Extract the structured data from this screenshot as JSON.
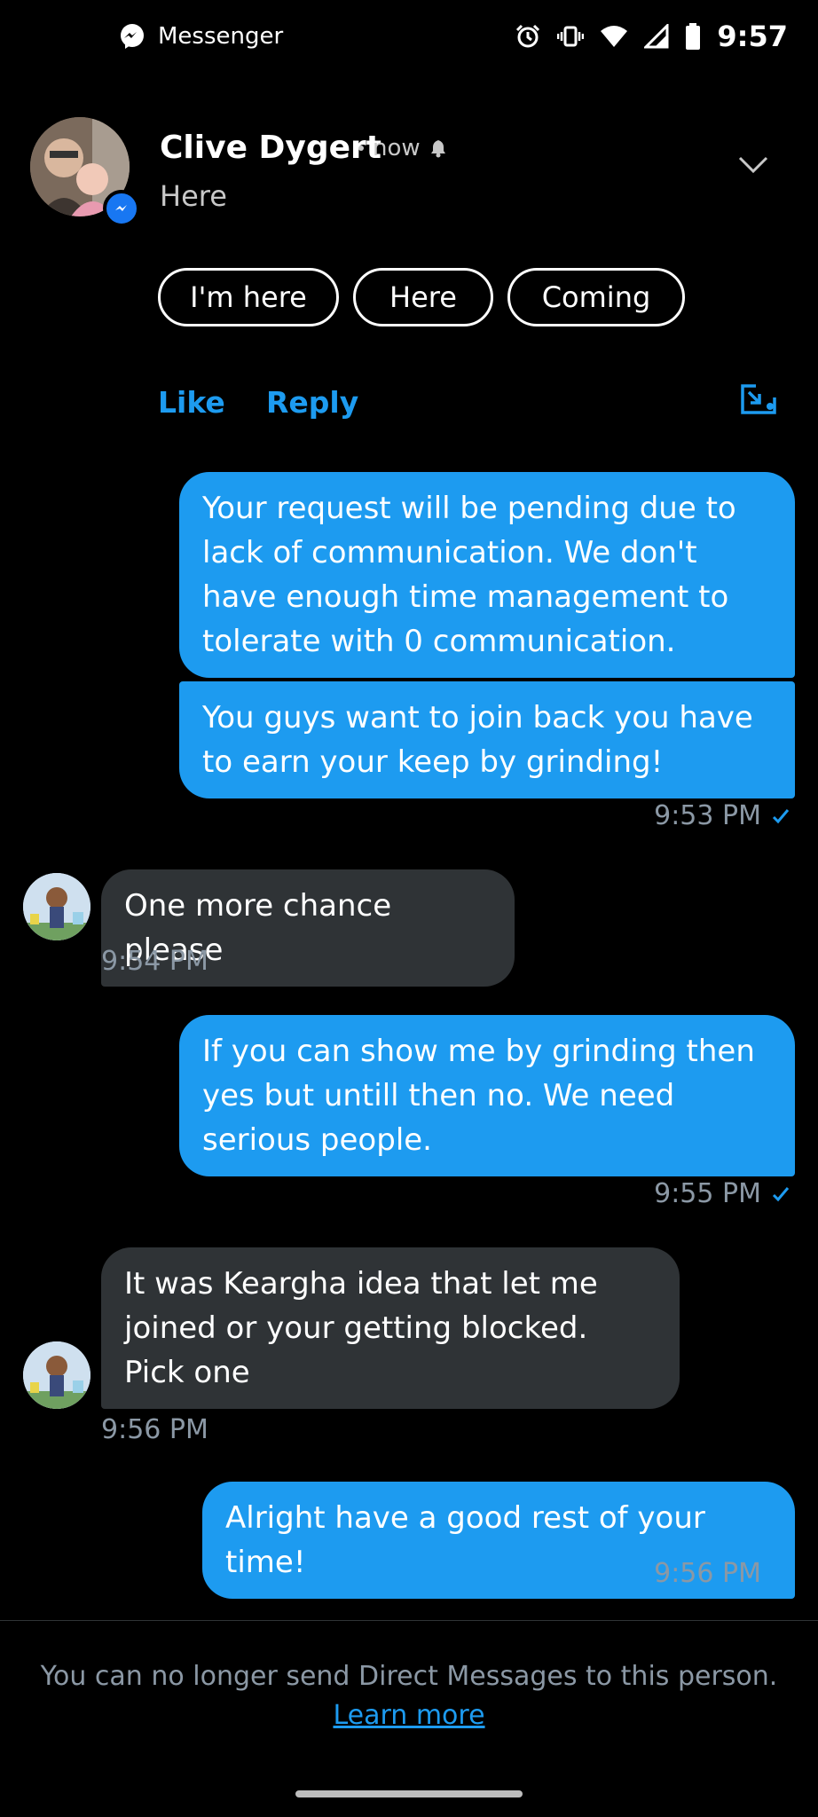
{
  "status_bar": {
    "app_name": "Messenger",
    "time": "9:57",
    "icons": [
      "alarm-icon",
      "vibrate-icon",
      "wifi-icon",
      "signal-icon",
      "battery-icon"
    ]
  },
  "notification": {
    "sender": "Clive Dygert",
    "time": "now",
    "message": "Here",
    "quick_replies": [
      "I'm here",
      "Here",
      "Coming"
    ],
    "actions": {
      "like": "Like",
      "reply": "Reply"
    }
  },
  "messages": [
    {
      "direction": "out",
      "text": "Your request will be pending due to lack of communication. We don't have enough time management to tolerate with 0 communication."
    },
    {
      "direction": "out",
      "text": "You guys want to join back you have to earn your keep by grinding!",
      "timestamp": "9:53 PM",
      "read": true
    },
    {
      "direction": "in",
      "text": "One more chance please",
      "timestamp": "9:54 PM"
    },
    {
      "direction": "out",
      "text": "If you can show me by grinding then yes but untill then no. We need serious people.",
      "timestamp": "9:55 PM",
      "read": true
    },
    {
      "direction": "in",
      "text": "It was Keargha idea that let me joined or your getting blocked. Pick one",
      "timestamp": "9:56 PM"
    },
    {
      "direction": "out",
      "text": "Alright have a good rest of your time!",
      "timestamp": "9:56 PM",
      "read": true
    }
  ],
  "footer": {
    "notice": "You can no longer send Direct Messages to this person.",
    "link": "Learn more"
  },
  "colors": {
    "accent": "#1d9bf0",
    "incoming_bubble": "#2f3336",
    "background": "#000000",
    "timestamp": "#8b98a5"
  }
}
